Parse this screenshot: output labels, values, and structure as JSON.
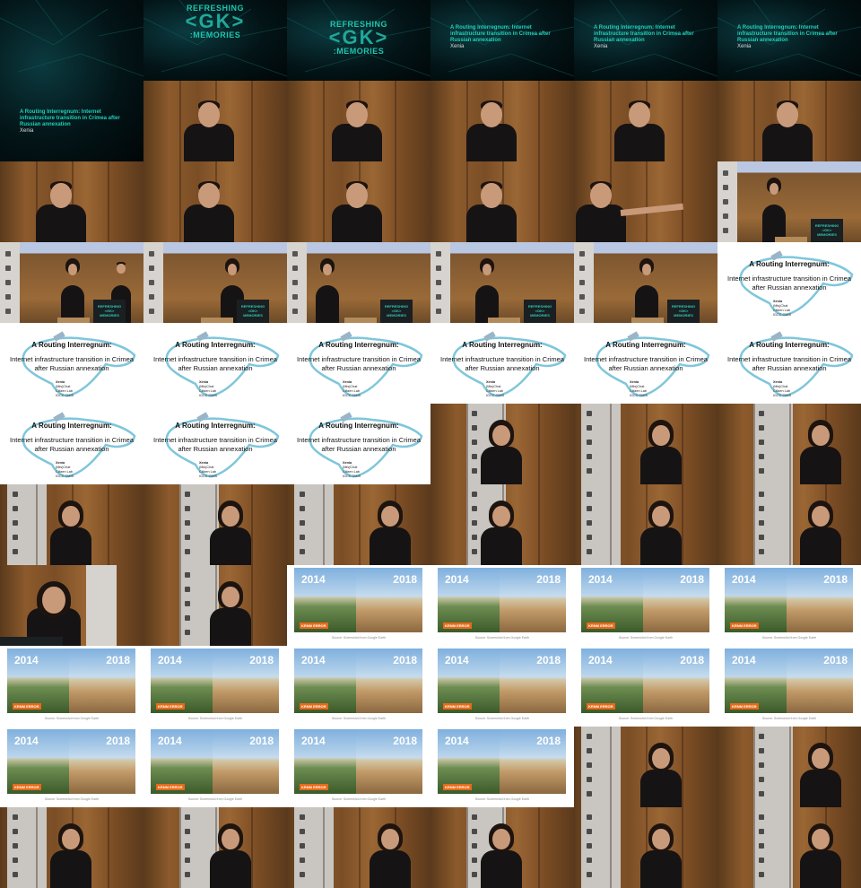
{
  "title_frame": {
    "logo_top": "REFRESHING",
    "logo_mark": "<GK>",
    "logo_bottom": ":MEMORIES",
    "talk_title": "A Routing Interregnum: Internet infrastructure transition in Crimea after Russian annexation",
    "author": "Xenia"
  },
  "slide_routing": {
    "title": "A Routing Interregnum:",
    "subtitle": "Internet infrastructure transition in Crimea after Russian annexation",
    "speaker": "Xenia",
    "affiliations": [
      "(Mis)Chat",
      "Citizen Lab",
      "IGCC CMIS"
    ]
  },
  "slide_years": {
    "year_left": "2014",
    "year_right": "2018",
    "badge": "KRNM ERROR",
    "source": "Source: Screenshot from Google Earth"
  },
  "lectern_logo": "REFRESHING <GK> MEMORIES",
  "colors": {
    "accent": "#1fc5ad",
    "background_dark": "#031417",
    "badge": "#e86a18"
  },
  "grid": {
    "cells": [
      "title-dark-left",
      "logo",
      "logo",
      "title-header",
      "title-header",
      "title-header",
      "speaker",
      "speaker",
      "speaker",
      "speaker",
      "speaker",
      "speaker",
      "speaker",
      "speaker",
      "speaker",
      "speaker",
      "speaker-arm",
      "stage-woman",
      "stage-man",
      "stage",
      "stage",
      "stage",
      "stage",
      "slide-routing",
      "slide-routing",
      "slide-routing",
      "slide-routing",
      "slide-routing",
      "slide-routing",
      "slide-routing",
      "slide-routing",
      "slide-routing",
      "slide-routing",
      "woman",
      "woman",
      "woman",
      "woman",
      "woman",
      "woman",
      "woman",
      "woman",
      "woman",
      "lectern",
      "woman",
      "slide-year",
      "slide-year",
      "slide-year",
      "slide-year",
      "slide-year",
      "slide-year",
      "slide-year",
      "slide-year",
      "slide-year",
      "slide-year",
      "slide-year",
      "slide-year",
      "slide-year",
      "slide-year",
      "woman",
      "woman",
      "woman",
      "woman",
      "woman",
      "woman",
      "woman",
      "woman"
    ]
  }
}
